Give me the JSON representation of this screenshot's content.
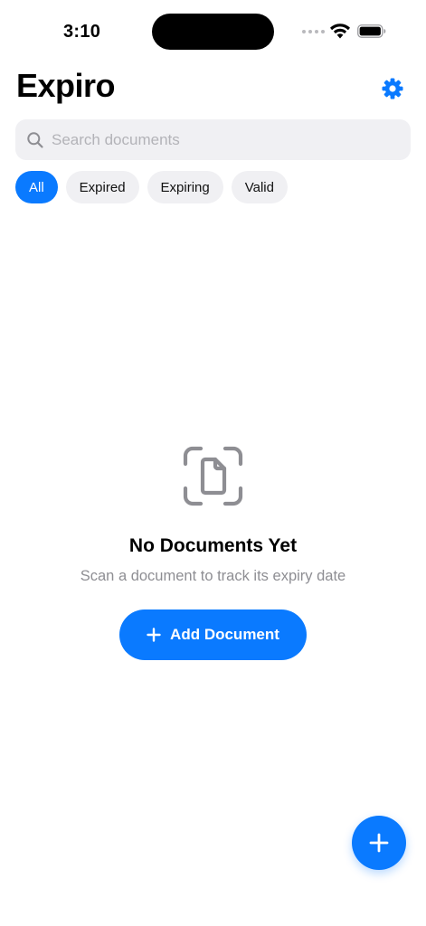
{
  "status_bar": {
    "time": "3:10"
  },
  "header": {
    "title": "Expiro",
    "settings_icon": "gear-icon"
  },
  "search": {
    "placeholder": "Search documents",
    "value": "",
    "icon": "search-icon"
  },
  "filters": {
    "selected": "All",
    "chips": [
      {
        "label": "All"
      },
      {
        "label": "Expired"
      },
      {
        "label": "Expiring"
      },
      {
        "label": "Valid"
      }
    ]
  },
  "empty_state": {
    "icon": "document-scan-icon",
    "title": "No Documents Yet",
    "subtitle": "Scan a document to track its expiry date",
    "button_label": "Add Document"
  },
  "fab": {
    "icon": "plus-icon"
  },
  "colors": {
    "accent": "#0A7AFF",
    "chip_background": "#F0F0F3",
    "secondary_text": "#8E8E93",
    "placeholder_text": "#B3B3B8"
  }
}
